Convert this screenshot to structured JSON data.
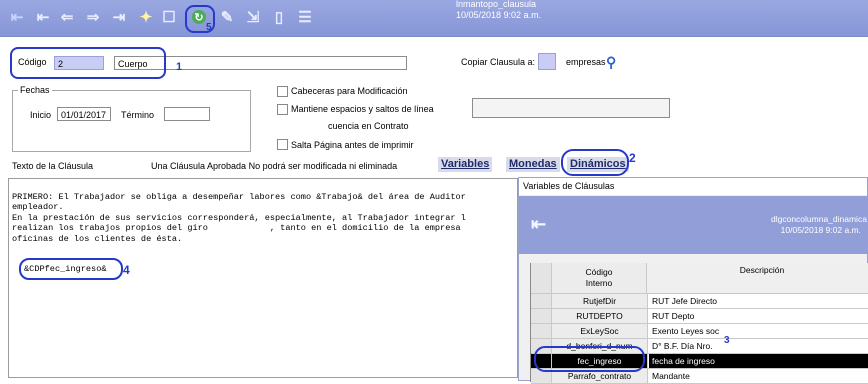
{
  "toolbar": {
    "record_name": "lnmantopo_clausula",
    "timestamp": "10/05/2018 9:02 a.m.",
    "refresh_marker": "5"
  },
  "form": {
    "codigo_label": "Código",
    "codigo_value": "2",
    "cuerpo_label": "Cuerpo",
    "marker_1": "1",
    "copiar_label": "Copiar Clausula a:",
    "empresas_label": "empresas",
    "fechas_legend": "Fechas",
    "inicio_label": "Inicio",
    "inicio_value": "01/01/2017",
    "termino_label": "Término",
    "termino_value": "",
    "check_cabeceras": "Cabeceras para Modificación",
    "check_mantiene": "Mantiene espacios y saltos de línea",
    "check_mantiene_2": "cuencia en Contrato",
    "check_salta": "Salta Página antes de imprimir",
    "texto_label": "Texto de la Cláusula",
    "aprobada_note": "Una Cláusula Aprobada No podrá  ser modificada ni eliminada"
  },
  "tabs": {
    "variables": "Variables",
    "monedas": "Monedas",
    "dinamicos": "Dinámicos",
    "marker_2": "2"
  },
  "clause_text": {
    "line1": "PRIMERO: El Trabajador se obliga a desempeñar labores como &Trabajo& del área de Auditor",
    "line2": "empleador.",
    "line3": "En la prestación de sus servicios corresponderá, especialmente, al Trabajador integrar l",
    "line4": "realizan los trabajos propios del giro            , tanto en el domicilio de la empresa",
    "line5": "oficinas de los clientes de ésta.",
    "token": "&CDPfec_ingreso&",
    "marker_4": "4"
  },
  "dialog": {
    "title": "Variables de Cláusulas",
    "record_name": "dlgconcolumna_dinamica",
    "timestamp": "10/05/2018 9:02 a.m.",
    "col_code": "Código",
    "col_code_2": "Interno",
    "col_desc": "Descripción",
    "marker_3": "3",
    "rows": [
      {
        "code": "RutjefDir",
        "desc": "RUT Jefe Directo"
      },
      {
        "code": "RUTDEPTO",
        "desc": "RUT Depto"
      },
      {
        "code": "ExLeySoc",
        "desc": "Exento Leyes soc"
      },
      {
        "code": "d_bonferi_d_num",
        "desc": "D° B.F. Día Nro."
      },
      {
        "code": "fec_ingreso",
        "desc": "fecha de ingreso"
      },
      {
        "code": "Parrafo_contrato",
        "desc": "Mandante"
      }
    ]
  }
}
